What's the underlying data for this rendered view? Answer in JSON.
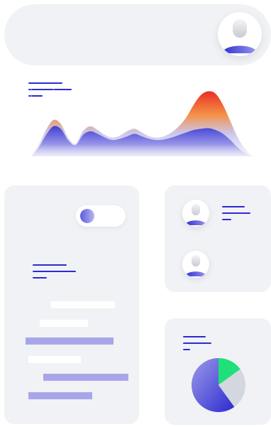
{
  "header": {
    "avatar": "user-avatar-icon"
  },
  "chart_data": {
    "type": "area",
    "title": "",
    "xlabel": "",
    "ylabel": "",
    "grid": true,
    "legend": "none",
    "x": [
      0,
      1,
      2,
      3,
      4,
      5,
      6,
      7,
      8,
      9,
      10,
      11,
      12,
      13,
      14,
      15,
      16,
      17,
      18,
      19,
      20,
      21,
      22,
      23,
      24,
      25,
      26,
      27,
      28,
      29,
      30
    ],
    "series": [
      {
        "color": "#ef3b1c",
        "values": [
          0,
          18,
          42,
          58,
          52,
          30,
          20,
          40,
          48,
          42,
          34,
          30,
          33,
          40,
          44,
          38,
          32,
          30,
          32,
          38,
          48,
          62,
          82,
          98,
          104,
          100,
          82,
          56,
          30,
          12,
          0
        ]
      },
      {
        "color": "#2e2fd0",
        "values": [
          0,
          14,
          34,
          48,
          44,
          26,
          18,
          34,
          40,
          36,
          30,
          26,
          28,
          32,
          36,
          32,
          28,
          26,
          27,
          30,
          34,
          38,
          42,
          44,
          45,
          42,
          36,
          26,
          14,
          5,
          0
        ]
      }
    ]
  },
  "profile_card": {
    "toggle": {
      "state": "off"
    }
  },
  "pie_card": {
    "chart_data": {
      "type": "pie",
      "slices": [
        {
          "value": 15,
          "color": "#1fe07a"
        },
        {
          "value": 25,
          "color": "#d3d8e0"
        },
        {
          "value": 60,
          "color": "#3a39d6"
        }
      ]
    }
  },
  "icons": {
    "person": "person-icon",
    "toggle_knob": "toggle-knob"
  }
}
